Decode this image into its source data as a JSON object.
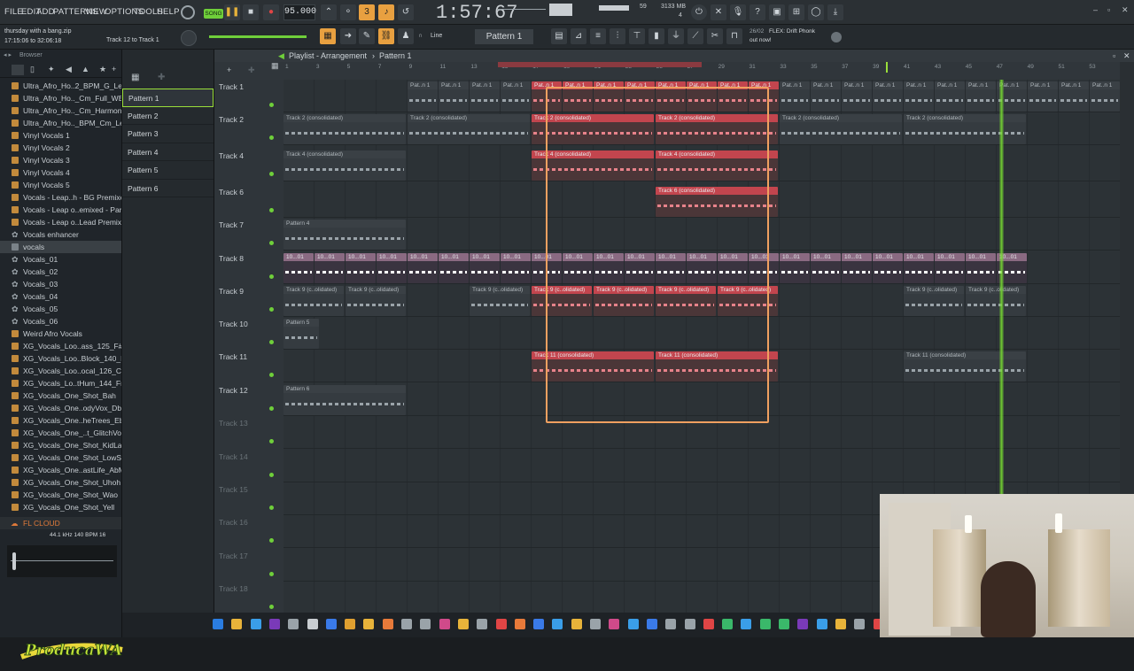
{
  "menu": [
    "FILE",
    "EDIT",
    "ADD",
    "PATTERNS",
    "VIEW",
    "OPTIONS",
    "TOOLS",
    "HELP"
  ],
  "transport": {
    "mode": "SONG",
    "tempo": "95.000",
    "time": "1:57:67",
    "cpu": "59",
    "mem": "3133 MB",
    "voices": "4"
  },
  "hint": {
    "project": "thursday with a bang.zip",
    "elapsed": "17:15:06 to 32:06:18",
    "track": "Track 12 to Track 1",
    "pattern_selector": "Pattern 1",
    "snap": "Line",
    "news_date": "26/02",
    "news_text": "FLEX: Drift Phonk",
    "news_text2": "out now!"
  },
  "browser": {
    "title": "Browser",
    "items": [
      {
        "label": "Ultra_Afro_Ho..2_BPM_G_Lead",
        "type": "file"
      },
      {
        "label": "Ultra_Afro_Ho.._Cm_Full_WET",
        "type": "file"
      },
      {
        "label": "Ultra_Afro_Ho.._Cm_Harmonies",
        "type": "file"
      },
      {
        "label": "Ultra_Afro_Ho.._BPM_Cm_Lead",
        "type": "file"
      },
      {
        "label": "Vinyl Vocals 1",
        "type": "file"
      },
      {
        "label": "Vinyl Vocals 2",
        "type": "file"
      },
      {
        "label": "Vinyl Vocals 3",
        "type": "file"
      },
      {
        "label": "Vinyl Vocals 4",
        "type": "file"
      },
      {
        "label": "Vinyl Vocals 5",
        "type": "file"
      },
      {
        "label": "Vocals - Leap..h - BG Premixed",
        "type": "file"
      },
      {
        "label": "Vocals - Leap o..emixed - Part_1",
        "type": "file"
      },
      {
        "label": "Vocals - Leap o..Lead Premixed",
        "type": "file"
      },
      {
        "label": "Vocals enhancer",
        "type": "preset"
      },
      {
        "label": "vocals",
        "type": "folder"
      },
      {
        "label": "Vocals_01",
        "type": "preset"
      },
      {
        "label": "Vocals_02",
        "type": "preset"
      },
      {
        "label": "Vocals_03",
        "type": "preset"
      },
      {
        "label": "Vocals_04",
        "type": "preset"
      },
      {
        "label": "Vocals_05",
        "type": "preset"
      },
      {
        "label": "Vocals_06",
        "type": "preset"
      },
      {
        "label": "Weird Afro Vocals",
        "type": "file"
      },
      {
        "label": "XG_Vocals_Loo..ass_125_F#Maj",
        "type": "file"
      },
      {
        "label": "XG_Vocals_Loo..Block_140_KEY",
        "type": "file"
      },
      {
        "label": "XG_Vocals_Loo..ocal_126_Cmin",
        "type": "file"
      },
      {
        "label": "XG_Vocals_Lo..tHum_144_Fmin",
        "type": "file"
      },
      {
        "label": "XG_Vocals_One_Shot_Bah",
        "type": "file"
      },
      {
        "label": "XG_Vocals_One..odyVox_Dbmin",
        "type": "file"
      },
      {
        "label": "XG_Vocals_One..heTrees_Ebmin",
        "type": "file"
      },
      {
        "label": "XG_Vocals_One_..t_GlitchVocal",
        "type": "file"
      },
      {
        "label": "XG_Vocals_One_Shot_KidLaugh",
        "type": "file"
      },
      {
        "label": "XG_Vocals_One_Shot_LowShot",
        "type": "file"
      },
      {
        "label": "XG_Vocals_One..astLife_AbMaj",
        "type": "file"
      },
      {
        "label": "XG_Vocals_One_Shot_Uhoh",
        "type": "file"
      },
      {
        "label": "XG_Vocals_One_Shot_Wao",
        "type": "file"
      },
      {
        "label": "XG_Vocals_One_Shot_Yell",
        "type": "file"
      }
    ],
    "cloud": "FL CLOUD",
    "sample_info": "44.1 kHz 140 BPM 16",
    "logo_text": "ProducaWA"
  },
  "patterns": [
    "Pattern 1",
    "Pattern 2",
    "Pattern 3",
    "Pattern 4",
    "Pattern 5",
    "Pattern 6"
  ],
  "playlist": {
    "title": "Playlist - Arrangement",
    "current_pattern": "Pattern 1",
    "ruler": [
      "1",
      "3",
      "5",
      "7",
      "9",
      "11",
      "13",
      "15",
      "17",
      "19",
      "21",
      "23",
      "25",
      "27",
      "29",
      "31",
      "33",
      "35",
      "37",
      "39",
      "41",
      "43",
      "45",
      "47",
      "49",
      "51",
      "53"
    ],
    "tracks": [
      "Track 1",
      "Track 2",
      "Track 4",
      "Track 6",
      "Track 7",
      "Track 8",
      "Track 9",
      "Track 10",
      "Track 11",
      "Track 12",
      "Track 13",
      "Track 14",
      "Track 15",
      "Track 16",
      "Track 17",
      "Track 18"
    ],
    "clip_labels": {
      "pat1": "Pat..n 1",
      "t2": "Track 2 (consolidated)",
      "t4": "Track 4 (consolidated)",
      "t6": "Track 6 (consolidated)",
      "p4": "Pattern 4",
      "t8": "10...01",
      "t9": "Track 9 (c..olidated)",
      "p5": "Pattern 5",
      "t11": "Track 11 (consolidated)",
      "p6": "Pattern 6"
    }
  }
}
